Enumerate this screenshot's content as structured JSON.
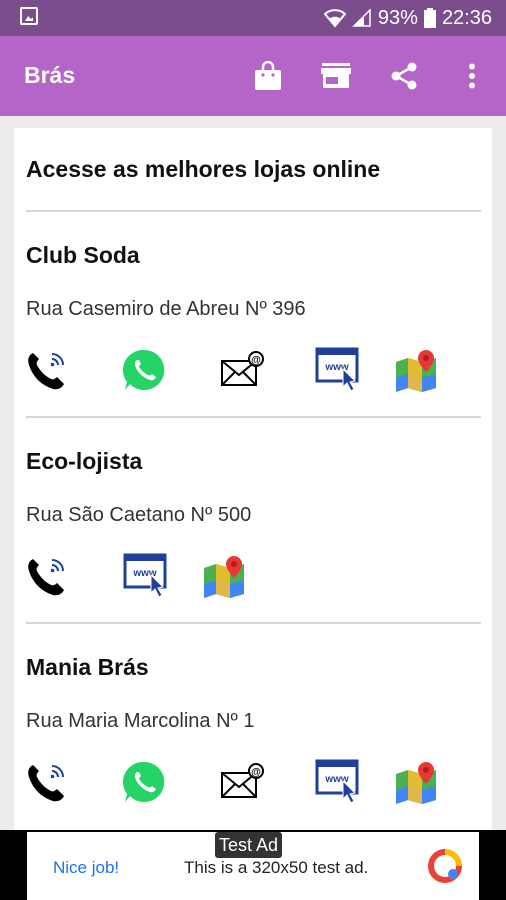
{
  "status_bar": {
    "battery": "93%",
    "time": "22:36",
    "icons": [
      "image-notification-icon",
      "wifi-icon",
      "signal-icon",
      "battery-icon"
    ]
  },
  "app_bar": {
    "title": "Brás",
    "actions": [
      "shopping-bag-icon",
      "store-icon",
      "share-icon",
      "more-vert-icon"
    ]
  },
  "heading": "Acesse as melhores lojas online",
  "stores": [
    {
      "name": "Club Soda",
      "address": "Rua Casemiro de Abreu Nº 396",
      "actions": [
        "phone-icon",
        "whatsapp-icon",
        "email-icon",
        "website-icon",
        "maps-icon"
      ]
    },
    {
      "name": "Eco-lojista",
      "address": "Rua São Caetano Nº 500",
      "actions": [
        "phone-icon",
        "website-icon",
        "maps-icon"
      ]
    },
    {
      "name": "Mania Brás",
      "address": "Rua Maria Marcolina Nº 1",
      "actions": [
        "phone-icon",
        "whatsapp-icon",
        "email-icon",
        "website-icon",
        "maps-icon"
      ]
    }
  ],
  "ad": {
    "label": "Test Ad",
    "nice": "Nice job!",
    "text": "This is a 320x50 test ad."
  },
  "colors": {
    "status_bar": "#7c4d8c",
    "app_bar": "#b565c8",
    "whatsapp": "#25d366",
    "web_blue": "#1f3f9a",
    "ad_link": "#1a73e8"
  }
}
